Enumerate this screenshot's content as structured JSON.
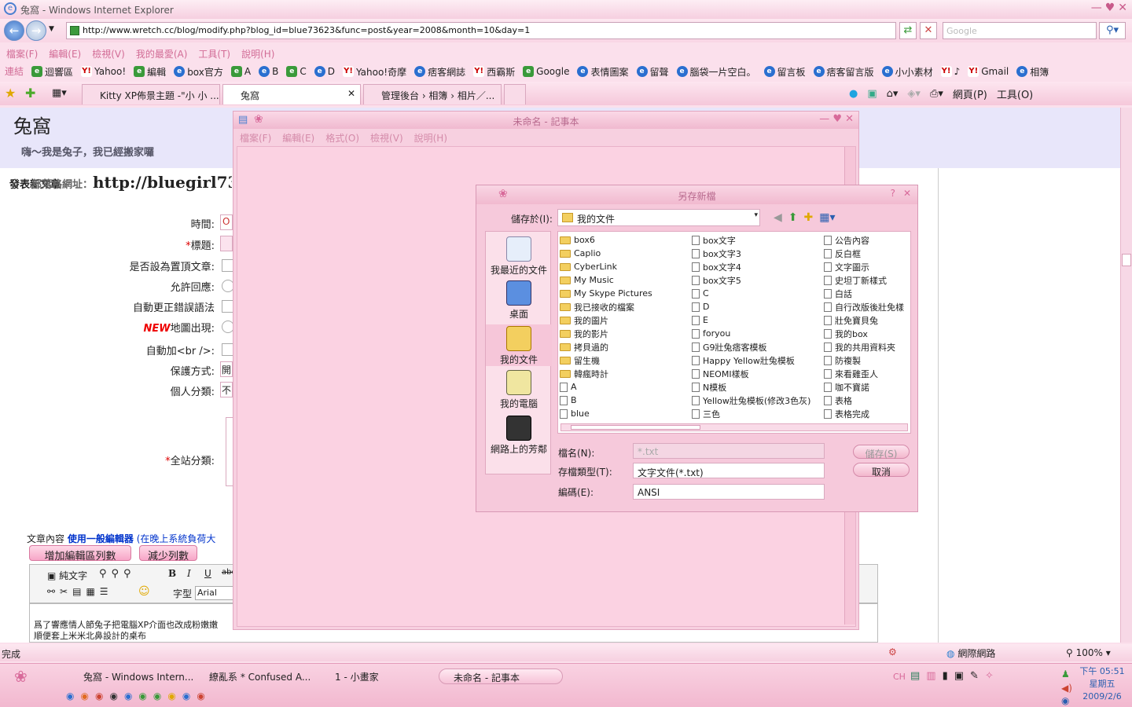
{
  "window": {
    "title": "兔窩 - Windows Internet Explorer"
  },
  "nav": {
    "url": "http://www.wretch.cc/blog/modify.php?blog_id=blue73623&func=post&year=2008&month=10&day=1",
    "search_placeholder": "Google"
  },
  "menu": [
    "檔案(F)",
    "編輯(E)",
    "檢視(V)",
    "我的最愛(A)",
    "工具(T)",
    "說明(H)"
  ],
  "links": {
    "label": "連結",
    "items": [
      "迴響區",
      "Yahoo!",
      "編輯",
      "box官方",
      "A",
      "B",
      "C",
      "D",
      "Yahoo!奇摩",
      "痞客網誌",
      "西霸斯",
      "Google",
      "表情圖案",
      "留聲",
      "腦袋一片空白。",
      "留言板",
      "痞客留言版",
      "小小素材",
      "♪",
      "Gmail",
      "相簿"
    ]
  },
  "tabs": [
    {
      "label": "Kitty XP佈景主題 -\"小 小 ..."
    },
    {
      "label": "兔窩"
    },
    {
      "label": "管理後台 › 相簿 › 相片／..."
    }
  ],
  "ie_tools": {
    "page": "網頁(P)",
    "tools": "工具(O)"
  },
  "blog": {
    "title": "兔窩",
    "subtitle": "嗨～我是兔子，我已經搬家囉",
    "section": "發表新文章",
    "url_prefix": "部落格網址：",
    "url": "http://bluegirl73"
  },
  "form": {
    "time": "時間:",
    "title": "標題:",
    "sticky": "是否設為置頂文章:",
    "allow_reply": "允許回應:",
    "autocorrect": "自動更正錯誤語法",
    "new_badge": "NEW",
    "map": "地圖出現:",
    "auto_br": "自動加<br />:",
    "privacy": "保護方式:",
    "category": "個人分類:",
    "site_category": "全站分類:",
    "time_value": "O",
    "privacy_value": "開",
    "category_value": "不"
  },
  "editor": {
    "content_label": "文章內容",
    "use_editor": "使用一般編輯器",
    "note": "(在晚上系統負荷大",
    "add_rows": "增加編輯區列數",
    "reduce_rows": "減少列數",
    "plain_text": "純文字",
    "font_label": "字型",
    "font_value": "Arial",
    "text": [
      "爲了響應情人節兔子把電腦XP介面也改成粉嫩嫩",
      "順便套上米米北鼻設計的桌布"
    ]
  },
  "notepad": {
    "title": "未命名 - 記事本",
    "menu": [
      "檔案(F)",
      "編輯(E)",
      "格式(O)",
      "檢視(V)",
      "說明(H)"
    ]
  },
  "dialog": {
    "title": "另存新檔",
    "save_in_label": "儲存於(I):",
    "save_in": "我的文件",
    "places": [
      "我最近的文件",
      "桌面",
      "我的文件",
      "我的電腦",
      "網路上的芳鄰"
    ],
    "files": [
      [
        "box6",
        "Caplio",
        "CyberLink",
        "My Music",
        "My Skype Pictures",
        "我已接收的檔案",
        "我的圖片",
        "我的影片",
        "拷貝過的",
        "留生機",
        "韓瘋時計",
        "A",
        "B",
        "blue"
      ],
      [
        "box文字",
        "box文字3",
        "box文字4",
        "box文字5",
        "C",
        "D",
        "E",
        "foryou",
        "G9壯兔痞客模板",
        "Happy Yellow壯兔模板",
        "NEOMI樣板",
        "N模板",
        "Yellow壯兔模板(修改3色灰)",
        "三色"
      ],
      [
        "公告內容",
        "反白框",
        "文字圖示",
        "史坦丁新樣式",
        "白話",
        "自行改版後壯免樣",
        "壯免寶貝兔",
        "我的box",
        "我的共用資料夾",
        "防複製",
        "來看雞歪人",
        "咖不寶諾",
        "表格",
        "表格完成"
      ]
    ],
    "folder_counts": [
      11,
      0,
      0
    ],
    "filename_label": "檔名(N):",
    "filename": "*.txt",
    "type_label": "存檔類型(T):",
    "type": "文字文件(*.txt)",
    "encoding_label": "編碼(E):",
    "encoding": "ANSI",
    "save": "儲存(S)",
    "cancel": "取消"
  },
  "status": {
    "text": "完成",
    "zone": "網際網路",
    "zoom": "100%"
  },
  "taskbar": {
    "items": [
      "兔窩 - Windows Intern...",
      "繚亂系 * Confused A...",
      "1 - 小畫家",
      "未命名 - 記事本"
    ],
    "lang": "CH",
    "time": "下午 05:51",
    "day": "星期五",
    "date": "2009/2/6"
  }
}
